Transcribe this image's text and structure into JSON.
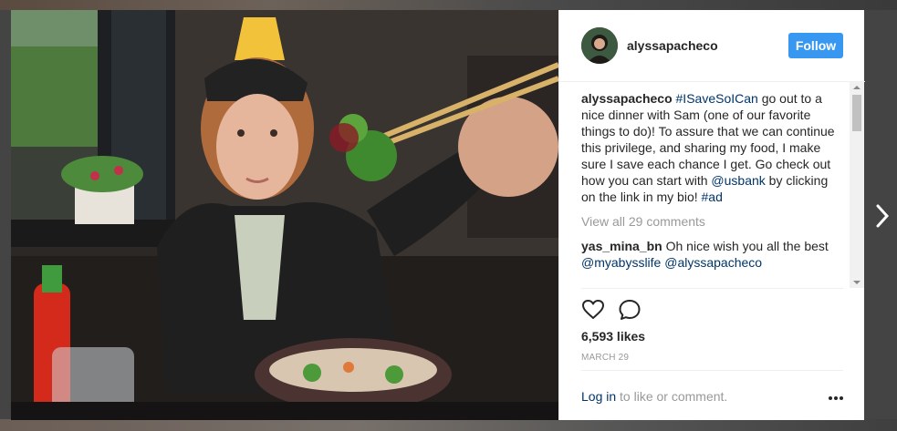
{
  "post": {
    "username": "alyssapacheco",
    "follow_label": "Follow",
    "caption_user": "alyssapacheco",
    "hashtag": "#ISaveSoICan",
    "caption_text_1": " go out to a nice dinner with Sam (one of our favorite things to do)! To assure that we can continue this privilege, and sharing my food, I make sure I save each chance I get. Go check out how you can start with ",
    "mention": "@usbank",
    "caption_text_2": " by clicking on the link in my bio! ",
    "hashtag_ad": "#ad",
    "view_all": "View all 29 comments",
    "comment_user": "yas_mina_bn",
    "comment_text": " Oh nice wish you all the best ",
    "comment_mention_1": "@myabysslife",
    "comment_mention_2": "@alyssapacheco",
    "likes": "6,593 likes",
    "date": "MARCH 29",
    "login_link": "Log in",
    "login_text": " to like or comment."
  },
  "icons": {
    "like": "heart-icon",
    "comment": "comment-icon",
    "more": "more-options-icon",
    "next": "chevron-right-icon"
  },
  "colors": {
    "follow_button": "#3897f0",
    "link": "#003569",
    "muted": "#999999"
  }
}
